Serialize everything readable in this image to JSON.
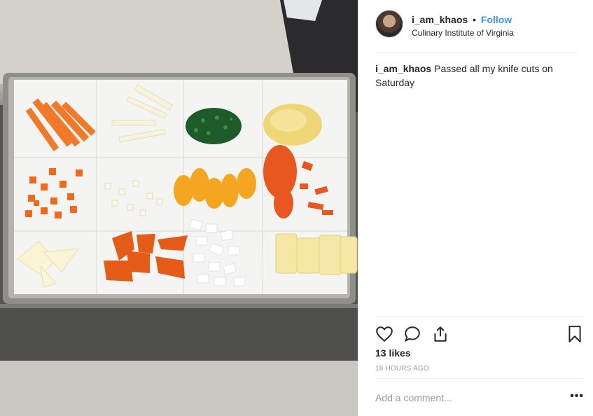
{
  "post": {
    "username": "i_am_khaos",
    "separator": "•",
    "follow_label": "Follow",
    "location": "Culinary Institute of Virginia",
    "caption_text": "Passed all my knife cuts on Saturday",
    "likes": "13 likes",
    "timestamp": "18 HOURS AGO",
    "comment_placeholder": "Add a comment...",
    "more_label": "•••"
  },
  "icons": {
    "like": "heart-icon",
    "comment": "comment-icon",
    "share": "share-icon",
    "save": "bookmark-icon"
  },
  "colors": {
    "follow": "#3897f0",
    "text": "#262626",
    "muted": "#999999",
    "divider": "#efefef"
  }
}
